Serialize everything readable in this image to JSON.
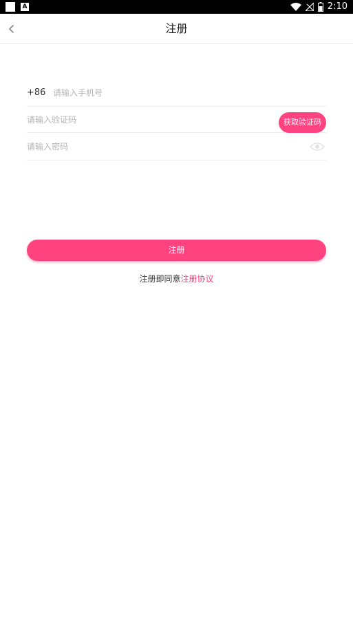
{
  "status_bar": {
    "time": "2:10",
    "left_badge": "A",
    "icons": [
      "wifi-icon",
      "signal-off-icon",
      "battery-icon"
    ]
  },
  "header": {
    "title": "注册",
    "back_icon": "chevron-left-icon"
  },
  "form": {
    "phone": {
      "prefix": "+86",
      "placeholder": "请输入手机号",
      "value": ""
    },
    "code": {
      "placeholder": "请输入验证码",
      "value": "",
      "button_label": "获取验证码"
    },
    "password": {
      "placeholder": "请输入密码",
      "value": "",
      "toggle_icon": "eye-icon"
    }
  },
  "submit_label": "注册",
  "agreement": {
    "text": "注册即同意",
    "link_text": "注册协议"
  },
  "colors": {
    "accent": "#ff4280",
    "link": "#ff3d7f",
    "divider": "#ececec"
  }
}
